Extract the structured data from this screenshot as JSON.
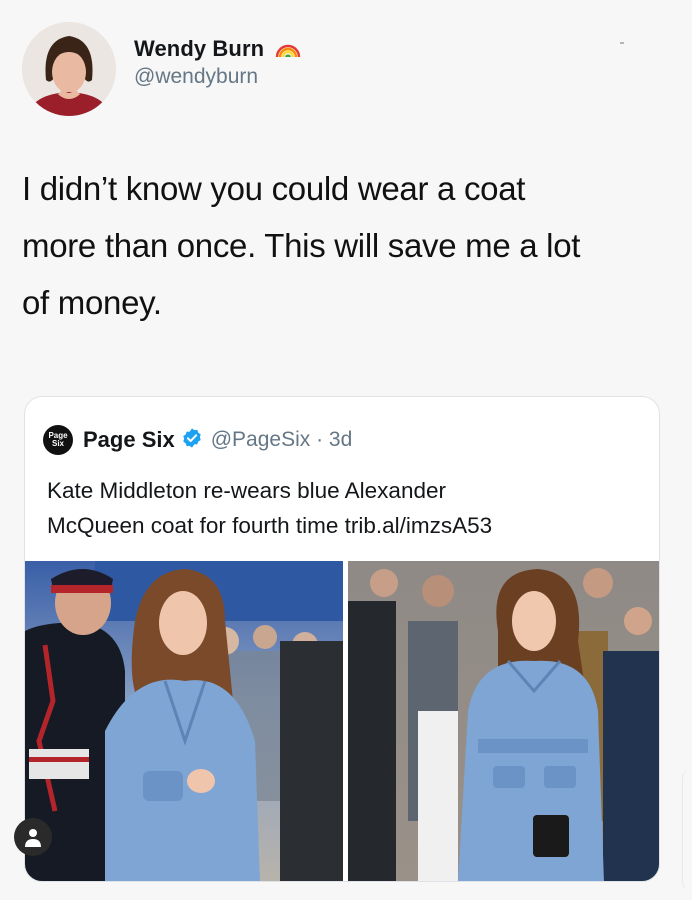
{
  "author": {
    "display_name": "Wendy Burn",
    "handle": "@wendyburn",
    "badge_icon": "rainbow-icon"
  },
  "tweet": {
    "lines": [
      "I didn’t know you could wear a coat",
      "more than once. This will save me a lot",
      "of money."
    ]
  },
  "quoted_tweet": {
    "logo_text": [
      "Page",
      "Six"
    ],
    "display_name": "Page Six",
    "verified_icon": "verified-badge-icon",
    "handle_time": "@PageSix · 3d",
    "text_lines": [
      "Kate Middleton re-wears blue Alexander",
      "McQueen coat for fourth time trib.al/imzsA53"
    ],
    "images": [
      "photo-left",
      "photo-right"
    ]
  },
  "colors": {
    "text": "#14171a",
    "secondary": "#657786",
    "verified": "#1da1f2",
    "coat_blue": "#7ea5d3"
  }
}
